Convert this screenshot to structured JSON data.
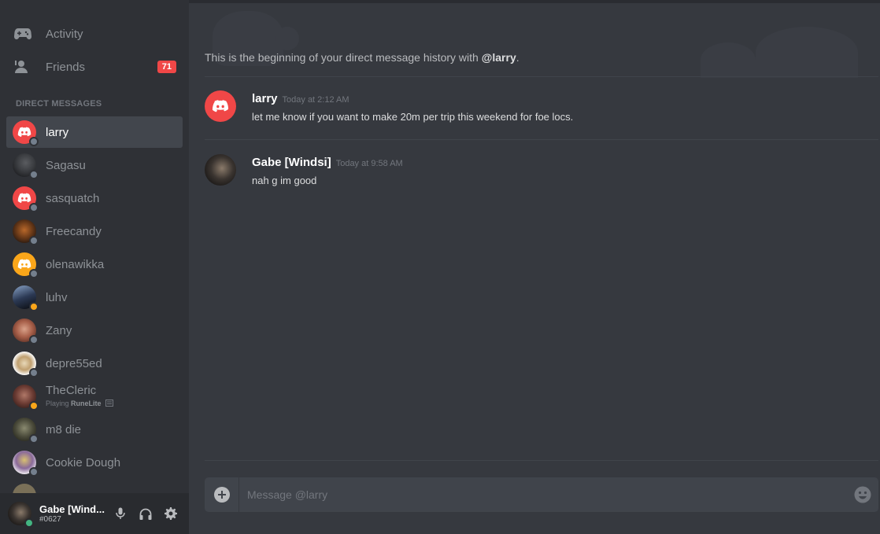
{
  "nav": {
    "activity_label": "Activity",
    "friends_label": "Friends",
    "friends_badge": "71"
  },
  "sidebar": {
    "dm_header": "DIRECT MESSAGES",
    "dms": [
      {
        "name": "larry",
        "status": "offline",
        "avatar": "discord-red-logo",
        "active": true
      },
      {
        "name": "Sagasu",
        "status": "offline",
        "avatar": "photo"
      },
      {
        "name": "sasquatch",
        "status": "offline",
        "avatar": "discord-red-logo"
      },
      {
        "name": "Freecandy",
        "status": "offline",
        "avatar": "photo"
      },
      {
        "name": "olenawikka",
        "status": "offline",
        "avatar": "discord-orange-logo"
      },
      {
        "name": "luhv",
        "status": "idle",
        "avatar": "photo"
      },
      {
        "name": "Zany",
        "status": "offline",
        "avatar": "photo"
      },
      {
        "name": "depre55ed",
        "status": "offline",
        "avatar": "photo"
      },
      {
        "name": "TheCleric",
        "status": "idle",
        "avatar": "photo",
        "activity_prefix": "Playing",
        "activity_game": "RuneLite"
      },
      {
        "name": "m8 die",
        "status": "offline",
        "avatar": "photo"
      },
      {
        "name": "Cookie Dough",
        "status": "offline",
        "avatar": "photo"
      }
    ]
  },
  "user": {
    "name": "Gabe [Wind...",
    "tag": "#0627",
    "status": "online"
  },
  "chat": {
    "intro_prefix": "This is the beginning of your direct message history with",
    "intro_mention": "@larry",
    "intro_suffix": ".",
    "messages": [
      {
        "author": "larry",
        "time": "Today at 2:12 AM",
        "text": "let me know if you want to make 20m per trip this weekend for foe locs."
      },
      {
        "author": "Gabe [Windsi]",
        "time": "Today at 9:58 AM",
        "text": "nah g im good"
      }
    ],
    "composer_placeholder": "Message @larry"
  },
  "colors": {
    "accent_red": "#f04747",
    "idle": "#faa61a",
    "online": "#43b581",
    "offline": "#747f8d"
  }
}
